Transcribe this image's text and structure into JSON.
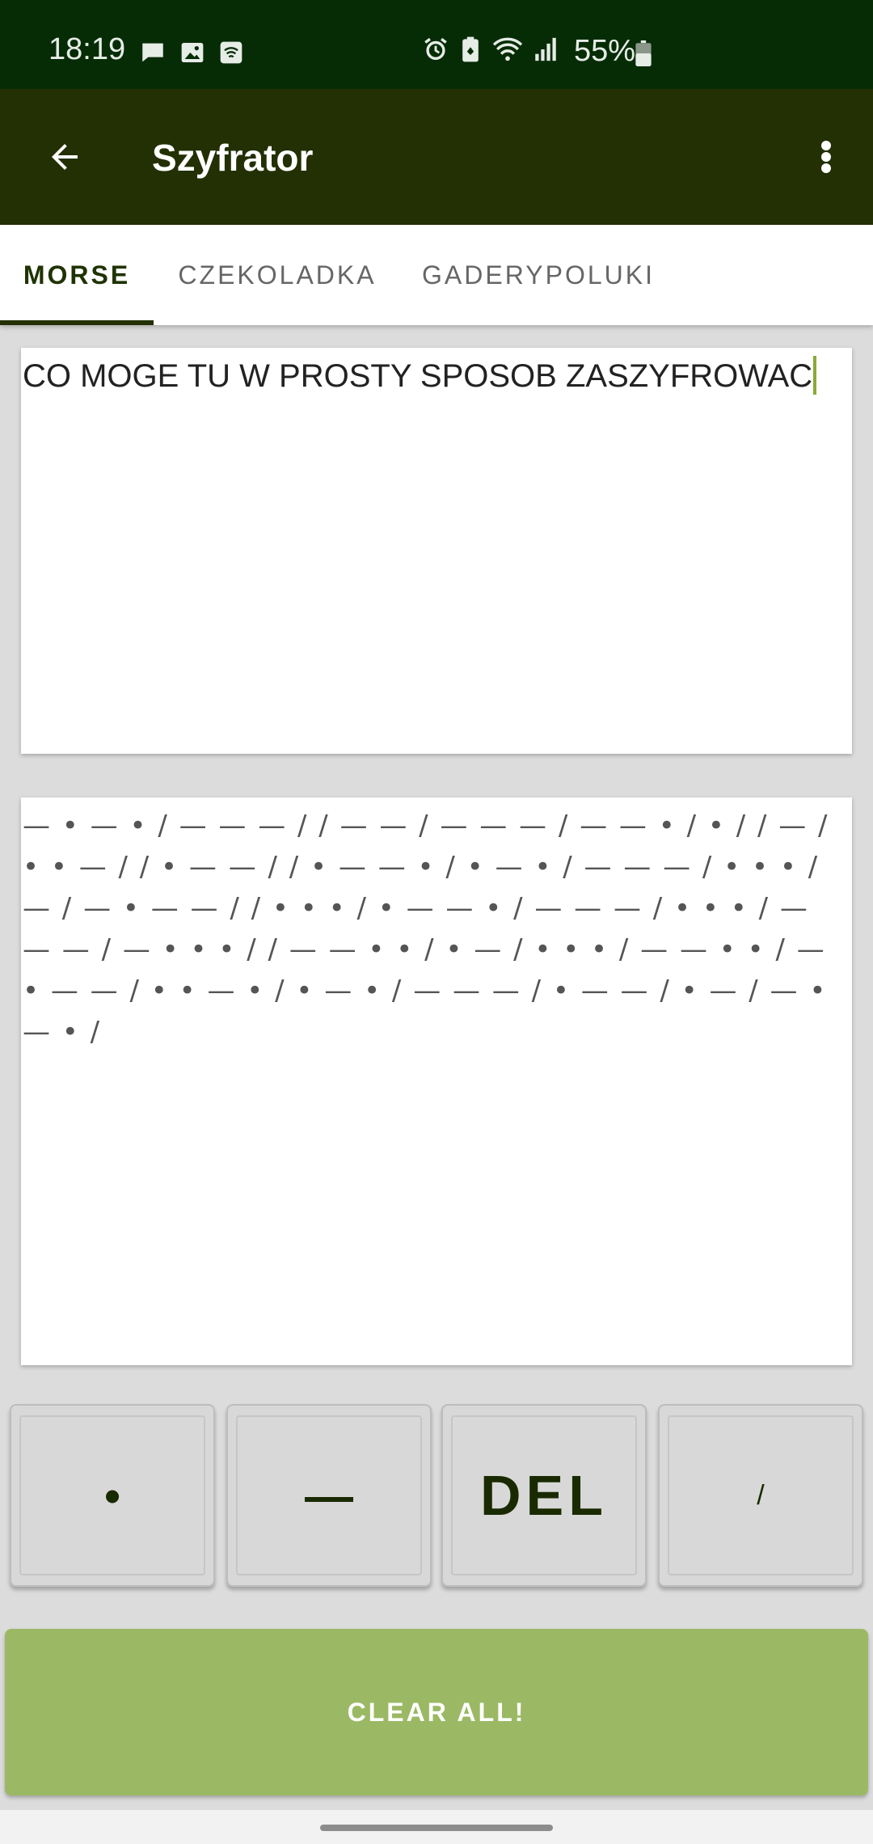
{
  "status_bar": {
    "time": "18:19",
    "battery": "55%",
    "left_icons": [
      "message-icon",
      "image-icon",
      "wifi-calling-icon"
    ],
    "right_icons": [
      "alarm-icon",
      "battery-saver-icon",
      "wifi-icon",
      "signal-icon",
      "battery-icon"
    ]
  },
  "app_bar": {
    "title": "Szyfrator"
  },
  "tabs": [
    {
      "label": "MORSE",
      "active": true
    },
    {
      "label": "CZEKOLADKA",
      "active": false
    },
    {
      "label": "GADERYPOLUKI",
      "active": false
    }
  ],
  "input": {
    "text": "CO MOGE TU W PROSTY SPOSOB ZASZYFROWAC"
  },
  "output": {
    "morse": "— • — • / — — — / / — — / — — — / — — • / • / / — / • • — / / • — — / / • — — • / • — • / — — — / • • • / — / — • — — / / • • • / • — — • / — — — / • • • / — — — / — • • • / / — — • • / • — / • • • / — — • • / — • — — / • • — • / • — • / — — — / • — — / • — / — • — • /"
  },
  "keypad": {
    "dot": "•",
    "dash": "—",
    "del": "DEL",
    "slash": "/"
  },
  "clear_button": "CLEAR ALL!",
  "colors": {
    "status_bar": "#062c06",
    "app_bar": "#223003",
    "accent": "#9bb964"
  }
}
